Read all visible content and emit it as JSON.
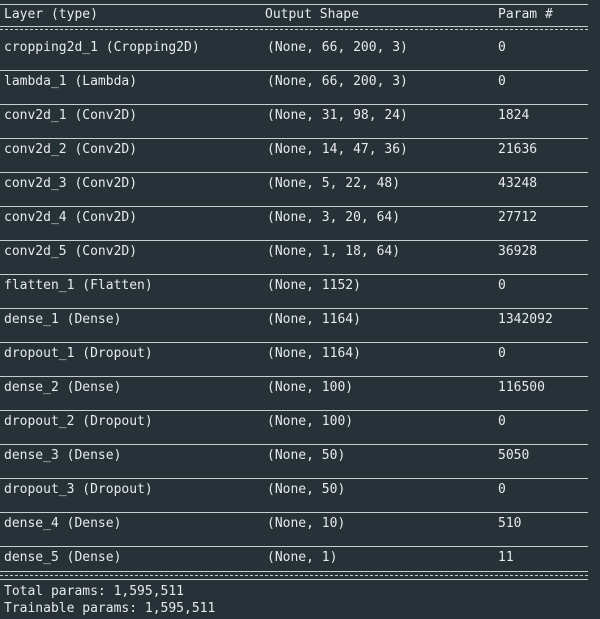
{
  "header": {
    "layer_label": "Layer (type)",
    "shape_label": "Output Shape",
    "param_label": "Param #"
  },
  "rows": [
    {
      "layer": "cropping2d_1 (Cropping2D)",
      "shape": "(None, 66, 200, 3)",
      "params": "0"
    },
    {
      "layer": "lambda_1 (Lambda)",
      "shape": "(None, 66, 200, 3)",
      "params": "0"
    },
    {
      "layer": "conv2d_1 (Conv2D)",
      "shape": "(None, 31, 98, 24)",
      "params": "1824"
    },
    {
      "layer": "conv2d_2 (Conv2D)",
      "shape": "(None, 14, 47, 36)",
      "params": "21636"
    },
    {
      "layer": "conv2d_3 (Conv2D)",
      "shape": "(None, 5, 22, 48)",
      "params": "43248"
    },
    {
      "layer": "conv2d_4 (Conv2D)",
      "shape": "(None, 3, 20, 64)",
      "params": "27712"
    },
    {
      "layer": "conv2d_5 (Conv2D)",
      "shape": "(None, 1, 18, 64)",
      "params": "36928"
    },
    {
      "layer": "flatten_1 (Flatten)",
      "shape": "(None, 1152)",
      "params": "0"
    },
    {
      "layer": "dense_1 (Dense)",
      "shape": "(None, 1164)",
      "params": "1342092"
    },
    {
      "layer": "dropout_1 (Dropout)",
      "shape": "(None, 1164)",
      "params": "0"
    },
    {
      "layer": "dense_2 (Dense)",
      "shape": "(None, 100)",
      "params": "116500"
    },
    {
      "layer": "dropout_2 (Dropout)",
      "shape": "(None, 100)",
      "params": "0"
    },
    {
      "layer": "dense_3 (Dense)",
      "shape": "(None, 50)",
      "params": "5050"
    },
    {
      "layer": "dropout_3 (Dropout)",
      "shape": "(None, 50)",
      "params": "0"
    },
    {
      "layer": "dense_4 (Dense)",
      "shape": "(None, 10)",
      "params": "510"
    },
    {
      "layer": "dense_5 (Dense)",
      "shape": "(None, 1)",
      "params": "11"
    }
  ],
  "footer": {
    "total": "Total params: 1,595,511",
    "trainable": "Trainable params: 1,595,511"
  }
}
